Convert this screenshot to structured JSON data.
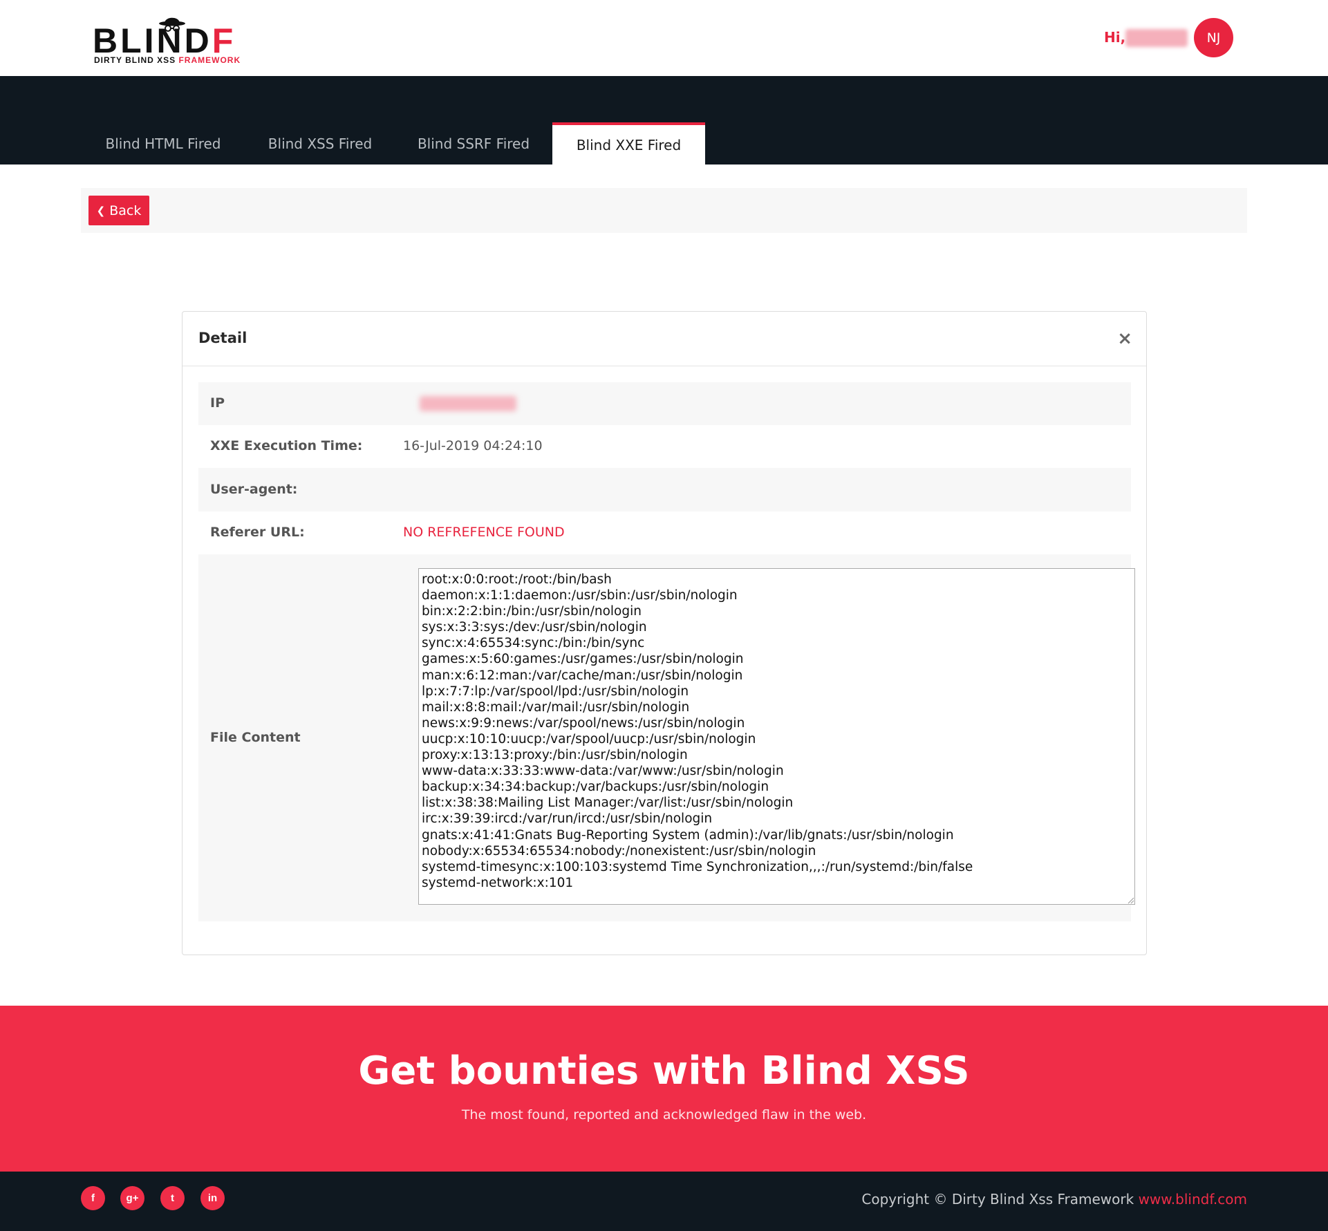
{
  "header": {
    "logo_word": "BLIND",
    "logo_word_accent": "F",
    "logo_tagline": "DIRTY BLIND XSS",
    "logo_tagline_accent": "FRAMEWORK",
    "greeting": "Hi,",
    "avatar_initials": "NJ"
  },
  "tabs": [
    {
      "label": "Blind HTML Fired"
    },
    {
      "label": "Blind XSS Fired"
    },
    {
      "label": "Blind SSRF Fired"
    },
    {
      "label": "Blind XXE Fired",
      "active": true
    }
  ],
  "back_button": {
    "label": "Back",
    "icon": "chevron-left-icon"
  },
  "detail": {
    "title": "Detail",
    "close_glyph": "×",
    "rows": [
      {
        "label": "IP",
        "value": ""
      },
      {
        "label": "XXE Execution Time:",
        "value": "16-Jul-2019 04:24:10"
      },
      {
        "label": "User-agent:",
        "value": ""
      },
      {
        "label": "Referer URL:",
        "value": "NO REFREFENCE FOUND"
      },
      {
        "label": "File Content",
        "value": ""
      }
    ],
    "file_content": "root:x:0:0:root:/root:/bin/bash\ndaemon:x:1:1:daemon:/usr/sbin:/usr/sbin/nologin\nbin:x:2:2:bin:/bin:/usr/sbin/nologin\nsys:x:3:3:sys:/dev:/usr/sbin/nologin\nsync:x:4:65534:sync:/bin:/bin/sync\ngames:x:5:60:games:/usr/games:/usr/sbin/nologin\nman:x:6:12:man:/var/cache/man:/usr/sbin/nologin\nlp:x:7:7:lp:/var/spool/lpd:/usr/sbin/nologin\nmail:x:8:8:mail:/var/mail:/usr/sbin/nologin\nnews:x:9:9:news:/var/spool/news:/usr/sbin/nologin\nuucp:x:10:10:uucp:/var/spool/uucp:/usr/sbin/nologin\nproxy:x:13:13:proxy:/bin:/usr/sbin/nologin\nwww-data:x:33:33:www-data:/var/www:/usr/sbin/nologin\nbackup:x:34:34:backup:/var/backups:/usr/sbin/nologin\nlist:x:38:38:Mailing List Manager:/var/list:/usr/sbin/nologin\nirc:x:39:39:ircd:/var/run/ircd:/usr/sbin/nologin\ngnats:x:41:41:Gnats Bug-Reporting System (admin):/var/lib/gnats:/usr/sbin/nologin\nnobody:x:65534:65534:nobody:/nonexistent:/usr/sbin/nologin\nsystemd-timesync:x:100:103:systemd Time Synchronization,,,:/run/systemd:/bin/false\nsystemd-network:x:101"
  },
  "promo": {
    "title": "Get bounties with Blind XSS",
    "subtitle": "The most found, reported and acknowledged flaw in the web."
  },
  "footer": {
    "social": [
      {
        "icon": "facebook-icon",
        "glyph": "f"
      },
      {
        "icon": "google-plus-icon",
        "glyph": "g+"
      },
      {
        "icon": "twitter-icon",
        "glyph": "t"
      },
      {
        "icon": "linkedin-icon",
        "glyph": "in"
      }
    ],
    "copyright_text": "Copyright © Dirty Blind Xss Framework",
    "copyright_link": "www.blindf.com"
  },
  "colors": {
    "accent": "#e8243f",
    "dark_band": "#0f1820",
    "promo_bg": "#f02d48",
    "row_shade": "#f7f7f7"
  }
}
